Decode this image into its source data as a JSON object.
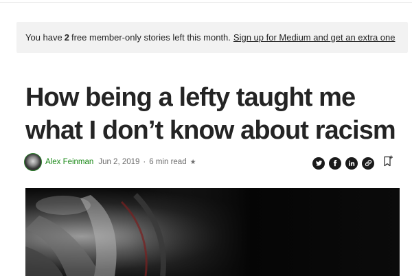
{
  "banner": {
    "text_before": "You have",
    "count": "2",
    "text_after": "free member-only stories left this month.",
    "link": "Sign up for Medium and get an extra one"
  },
  "article": {
    "title": "How being a lefty taught me what I don’t know about racism",
    "author": "Alex Feinman",
    "date": "Jun 2, 2019",
    "separator": "·",
    "read_time": "6 min read",
    "member_star": "★"
  },
  "share_icons": [
    "twitter-icon",
    "facebook-icon",
    "linkedin-icon",
    "link-icon",
    "bookmark-icon"
  ],
  "colors": {
    "author_green": "#1a8917",
    "banner_bg": "#f2f2f2",
    "text": "#242424",
    "muted": "#6b6b6b"
  }
}
